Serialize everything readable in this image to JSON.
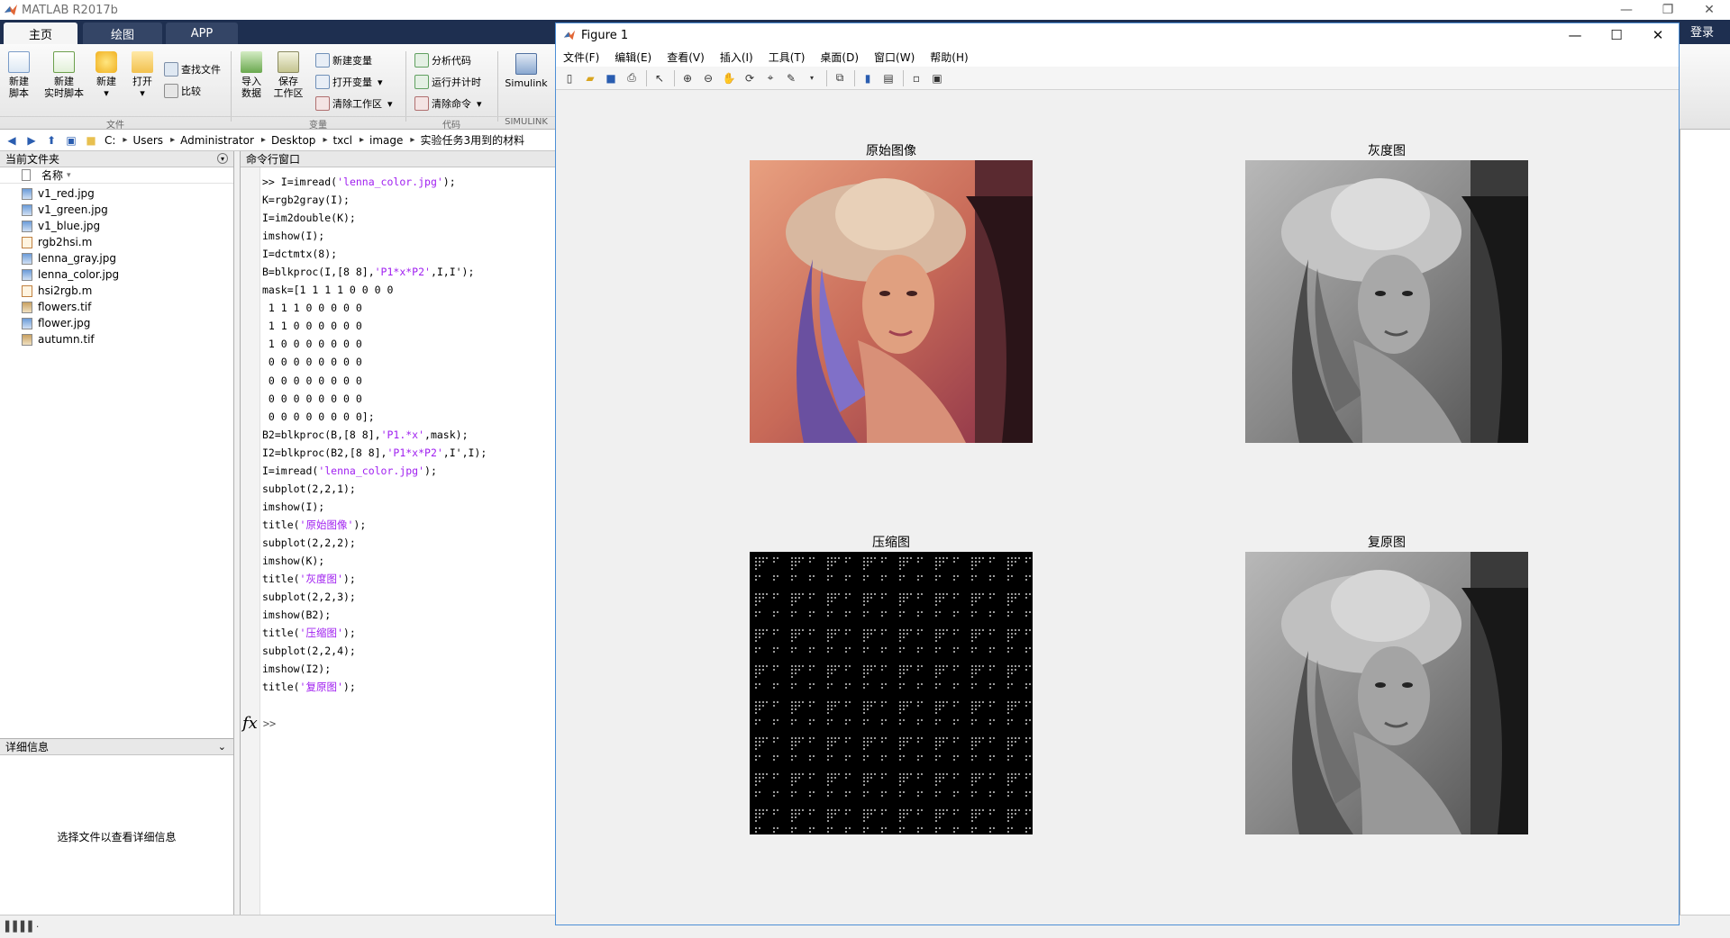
{
  "app": {
    "title": "MATLAB R2017b",
    "tabs": [
      "主页",
      "绘图",
      "APP"
    ],
    "login": "登录"
  },
  "toolstrip": {
    "new_script": "新建\n脚本",
    "new_live_script": "新建\n实时脚本",
    "new": "新建",
    "open": "打开",
    "find_files": "查找文件",
    "compare": "比较",
    "import_data": "导入\n数据",
    "save_workspace": "保存\n工作区",
    "new_variable": "新建变量",
    "open_variable": "打开变量",
    "clear_workspace": "清除工作区",
    "analyze_code": "分析代码",
    "run_and_time": "运行并计时",
    "clear_commands": "清除命令",
    "simulink": "Simulink",
    "groups": [
      "文件",
      "变量",
      "代码",
      "SIMULINK"
    ]
  },
  "address": {
    "path": [
      "C:",
      "Users",
      "Administrator",
      "Desktop",
      "txcl",
      "image",
      "实验任务3用到的材料"
    ]
  },
  "current_folder": {
    "title": "当前文件夹",
    "column": "名称",
    "files": [
      {
        "name": "v1_red.jpg",
        "type": "img"
      },
      {
        "name": "v1_green.jpg",
        "type": "img"
      },
      {
        "name": "v1_blue.jpg",
        "type": "img"
      },
      {
        "name": "rgb2hsi.m",
        "type": "m"
      },
      {
        "name": "lenna_gray.jpg",
        "type": "img"
      },
      {
        "name": "lenna_color.jpg",
        "type": "img"
      },
      {
        "name": "hsi2rgb.m",
        "type": "m"
      },
      {
        "name": "flowers.tif",
        "type": "tif"
      },
      {
        "name": "flower.jpg",
        "type": "img"
      },
      {
        "name": "autumn.tif",
        "type": "tif"
      }
    ]
  },
  "details": {
    "title": "详细信息",
    "message": "选择文件以查看详细信息"
  },
  "command_window": {
    "title": "命令行窗口",
    "lines": [
      ">> I=imread('lenna_color.jpg');",
      "K=rgb2gray(I);",
      "I=im2double(K);",
      "imshow(I);",
      "I=dctmtx(8);",
      "B=blkproc(I,[8 8],'P1*x*P2',I,I');",
      "mask=[1 1 1 1 0 0 0 0",
      " 1 1 1 0 0 0 0 0",
      " 1 1 0 0 0 0 0 0",
      " 1 0 0 0 0 0 0 0",
      " 0 0 0 0 0 0 0 0",
      " 0 0 0 0 0 0 0 0",
      " 0 0 0 0 0 0 0 0",
      " 0 0 0 0 0 0 0 0];",
      "B2=blkproc(B,[8 8],'P1.*x',mask);",
      "I2=blkproc(B2,[8 8],'P1*x*P2',I',I);",
      "I=imread('lenna_color.jpg');",
      "subplot(2,2,1);",
      "imshow(I);",
      "title('原始图像');",
      "subplot(2,2,2);",
      "imshow(K);",
      "title('灰度图');",
      "subplot(2,2,3);",
      "imshow(B2);",
      "title('压缩图');",
      "subplot(2,2,4);",
      "imshow(I2);",
      "title('复原图');"
    ],
    "prompt": ">>",
    "fx": "fx"
  },
  "figure": {
    "title": "Figure 1",
    "menu": [
      "文件(F)",
      "编辑(E)",
      "查看(V)",
      "插入(I)",
      "工具(T)",
      "桌面(D)",
      "窗口(W)",
      "帮助(H)"
    ],
    "subplots": [
      {
        "title": "原始图像",
        "kind": "color"
      },
      {
        "title": "灰度图",
        "kind": "gray"
      },
      {
        "title": "压缩图",
        "kind": "compressed"
      },
      {
        "title": "复原图",
        "kind": "gray"
      }
    ]
  },
  "colors": {
    "ribbon_bg": "#1e2f50",
    "string_literal": "#a020f0",
    "figure_border": "#4d8fd6"
  }
}
